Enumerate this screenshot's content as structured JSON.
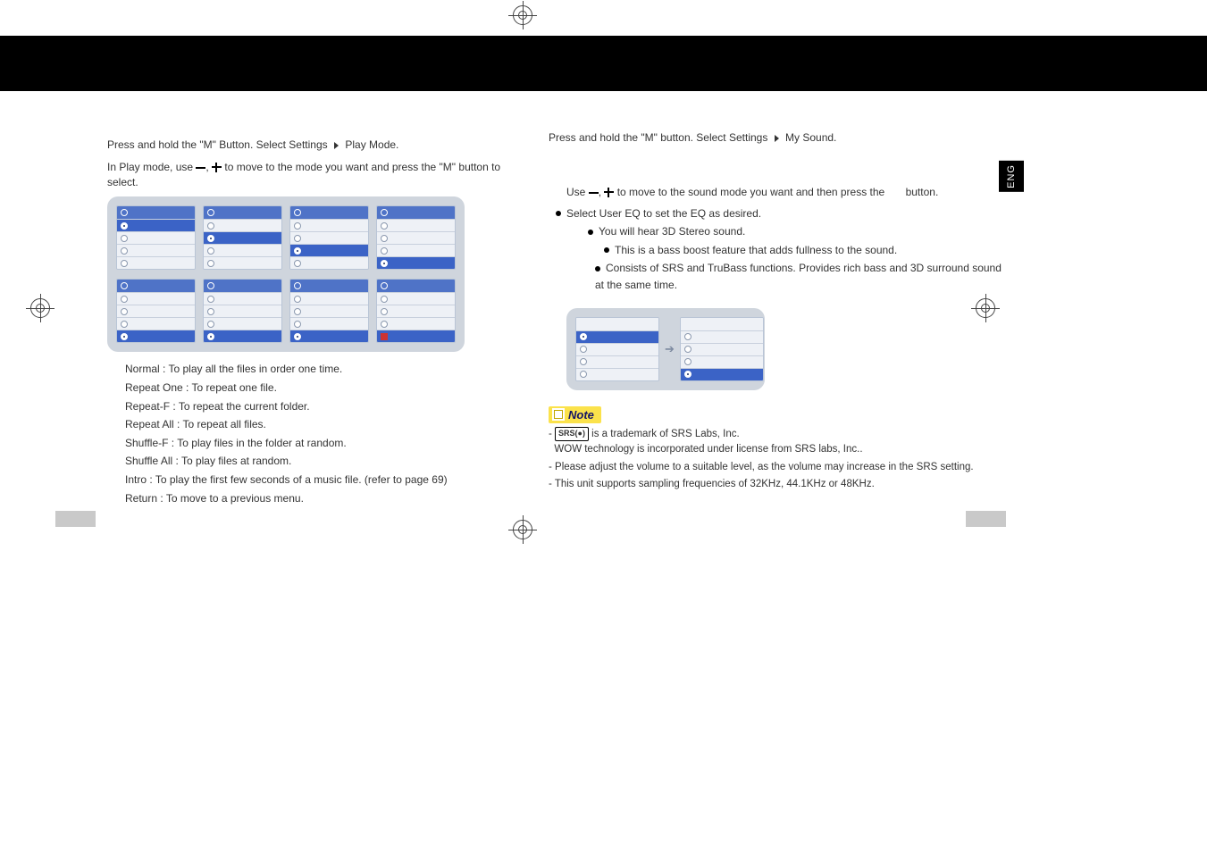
{
  "language_tab": "ENG",
  "left": {
    "heading_prefix": "Press and hold the \"M\" Button. Select Settings",
    "heading_suffix": "Play Mode.",
    "step2_prefix": "In Play mode, use ",
    "step2_mid": ", ",
    "step2_suffix": " to move to the mode you want and press the \"M\" button to select.",
    "modes": [
      {
        "label": "Normal",
        "desc": "To play all the files in order one time."
      },
      {
        "label": "Repeat One",
        "desc": "To repeat one file."
      },
      {
        "label": "Repeat-F",
        "desc": "To repeat the current folder."
      },
      {
        "label": "Repeat All",
        "desc": "To repeat all files."
      },
      {
        "label": "Shuffle-F",
        "desc": "To play files in the folder at random."
      },
      {
        "label": "Shuffle All",
        "desc": "To play files at random."
      },
      {
        "label": "Intro",
        "desc": "To play the first few seconds of a music file. (refer to page 69)"
      },
      {
        "label": "Return",
        "desc": "To move to a previous menu."
      }
    ]
  },
  "right": {
    "heading_prefix": "Press and hold the \"M\" button. Select Settings",
    "heading_suffix": "My Sound.",
    "step2_prefix": "Use ",
    "step2_mid": ", ",
    "step2_suffix": " to move to the sound mode you want and then press the",
    "step2_tail": "button.",
    "defs": [
      {
        "desc": "Select User EQ to set the EQ as desired."
      },
      {
        "desc": "You will hear 3D Stereo sound."
      },
      {
        "desc": "This is a bass boost feature that adds fullness to the sound."
      },
      {
        "desc": "Consists of SRS and TruBass functions. Provides rich bass and 3D surround sound at the same time."
      }
    ],
    "note_label": "Note",
    "notes": [
      {
        "prefix": "- ",
        "srs": "SRS(●)",
        "line1": " is a trademark of SRS Labs, Inc.",
        "line2": "WOW technology is incorporated under license from SRS labs, Inc.."
      },
      {
        "text": "- Please adjust the volume to a suitable level, as the volume may increase in the SRS setting."
      },
      {
        "text": "- This unit supports sampling frequencies of 32KHz, 44.1KHz or 48KHz."
      }
    ]
  }
}
